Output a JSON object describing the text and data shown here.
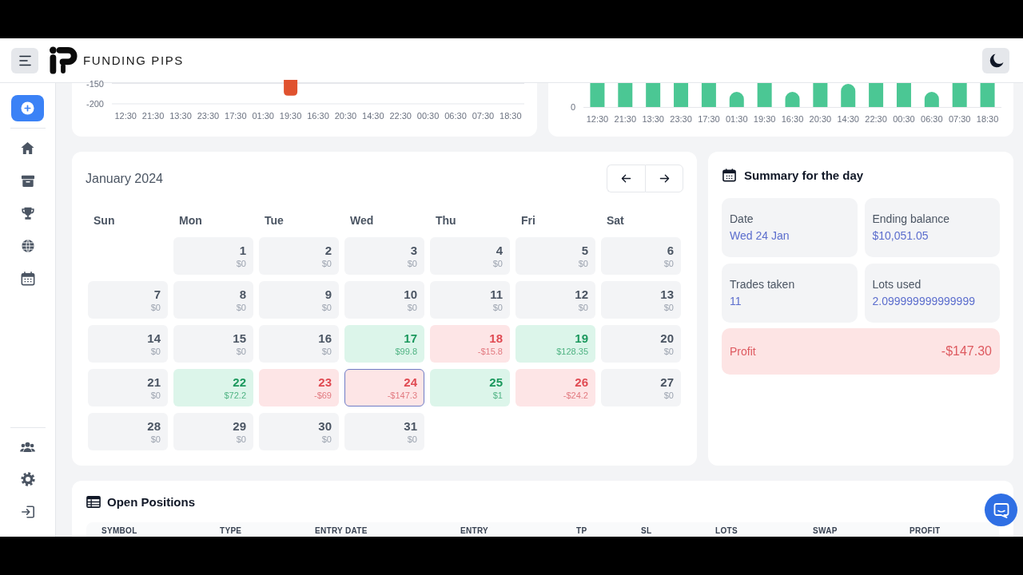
{
  "header": {
    "brand": "FUNDING PIPS"
  },
  "left_chart": {
    "chart_data": {
      "type": "bar",
      "categories": [
        "12:30",
        "21:30",
        "13:30",
        "23:30",
        "17:30",
        "01:30",
        "19:30",
        "16:30",
        "20:30",
        "14:30",
        "22:30",
        "00:30",
        "06:30",
        "07:30",
        "18:30"
      ],
      "values": [
        null,
        null,
        null,
        null,
        null,
        null,
        -180,
        null,
        null,
        null,
        null,
        null,
        null,
        null,
        null
      ],
      "color": "#e0522f",
      "yticks": [
        -200,
        -150
      ],
      "ylim": [
        -200,
        -141
      ]
    }
  },
  "right_chart": {
    "y_labels": [
      "0"
    ],
    "x_labels": [
      "12:30",
      "21:30",
      "13:30",
      "23:30",
      "17:30",
      "01:30",
      "19:30",
      "16:30",
      "20:30",
      "14:30",
      "22:30",
      "00:30",
      "06:30",
      "07:30",
      "18:30"
    ]
  },
  "calendar": {
    "title": "January 2024",
    "weekdays": [
      "Sun",
      "Mon",
      "Tue",
      "Wed",
      "Thu",
      "Fri",
      "Sat"
    ],
    "weeks": [
      [
        {
          "day": "1",
          "amount": "$0",
          "kind": "flat",
          "selected": false
        },
        {
          "day": "2",
          "amount": "$0",
          "kind": "flat",
          "selected": false
        },
        {
          "day": "3",
          "amount": "$0",
          "kind": "flat",
          "selected": false
        },
        {
          "day": "4",
          "amount": "$0",
          "kind": "flat",
          "selected": false
        },
        {
          "day": "5",
          "amount": "$0",
          "kind": "flat",
          "selected": false
        },
        {
          "day": "6",
          "amount": "$0",
          "kind": "flat",
          "selected": false
        }
      ],
      [
        {
          "day": "7",
          "amount": "$0",
          "kind": "flat",
          "selected": false
        },
        {
          "day": "8",
          "amount": "$0",
          "kind": "flat",
          "selected": false
        },
        {
          "day": "9",
          "amount": "$0",
          "kind": "flat",
          "selected": false
        },
        {
          "day": "10",
          "amount": "$0",
          "kind": "flat",
          "selected": false
        },
        {
          "day": "11",
          "amount": "$0",
          "kind": "flat",
          "selected": false
        },
        {
          "day": "12",
          "amount": "$0",
          "kind": "flat",
          "selected": false
        },
        {
          "day": "13",
          "amount": "$0",
          "kind": "flat",
          "selected": false
        }
      ],
      [
        {
          "day": "14",
          "amount": "$0",
          "kind": "flat",
          "selected": false
        },
        {
          "day": "15",
          "amount": "$0",
          "kind": "flat",
          "selected": false
        },
        {
          "day": "16",
          "amount": "$0",
          "kind": "flat",
          "selected": false
        },
        {
          "day": "17",
          "amount": "$99.8",
          "kind": "profit",
          "selected": false
        },
        {
          "day": "18",
          "amount": "-$15.8",
          "kind": "loss",
          "selected": false
        },
        {
          "day": "19",
          "amount": "$128.35",
          "kind": "profit",
          "selected": false
        },
        {
          "day": "20",
          "amount": "$0",
          "kind": "flat",
          "selected": false
        }
      ],
      [
        {
          "day": "21",
          "amount": "$0",
          "kind": "flat",
          "selected": false
        },
        {
          "day": "22",
          "amount": "$72.2",
          "kind": "profit",
          "selected": false
        },
        {
          "day": "23",
          "amount": "-$69",
          "kind": "loss",
          "selected": false
        },
        {
          "day": "24",
          "amount": "-$147.3",
          "kind": "loss",
          "selected": true
        },
        {
          "day": "25",
          "amount": "$1",
          "kind": "profit",
          "selected": false
        },
        {
          "day": "26",
          "amount": "-$24.2",
          "kind": "loss",
          "selected": false
        },
        {
          "day": "27",
          "amount": "$0",
          "kind": "flat",
          "selected": false
        }
      ],
      [
        {
          "day": "28",
          "amount": "$0",
          "kind": "flat",
          "selected": false
        },
        {
          "day": "29",
          "amount": "$0",
          "kind": "flat",
          "selected": false
        },
        {
          "day": "30",
          "amount": "$0",
          "kind": "flat",
          "selected": false
        },
        {
          "day": "31",
          "amount": "$0",
          "kind": "flat",
          "selected": false
        }
      ]
    ]
  },
  "summary": {
    "title": "Summary for the day",
    "stats": [
      {
        "label": "Date",
        "value": "Wed 24 Jan"
      },
      {
        "label": "Ending balance",
        "value": "$10,051.05"
      },
      {
        "label": "Trades taken",
        "value": "11"
      },
      {
        "label": "Lots used",
        "value": "2.099999999999999"
      }
    ],
    "profit": {
      "label": "Profit",
      "value": "-$147.30",
      "kind": "loss"
    }
  },
  "open_positions": {
    "title": "Open Positions",
    "columns": [
      "SYMBOL",
      "TYPE",
      "ENTRY DATE",
      "ENTRY",
      "TP",
      "SL",
      "LOTS",
      "SWAP",
      "PROFIT"
    ]
  }
}
